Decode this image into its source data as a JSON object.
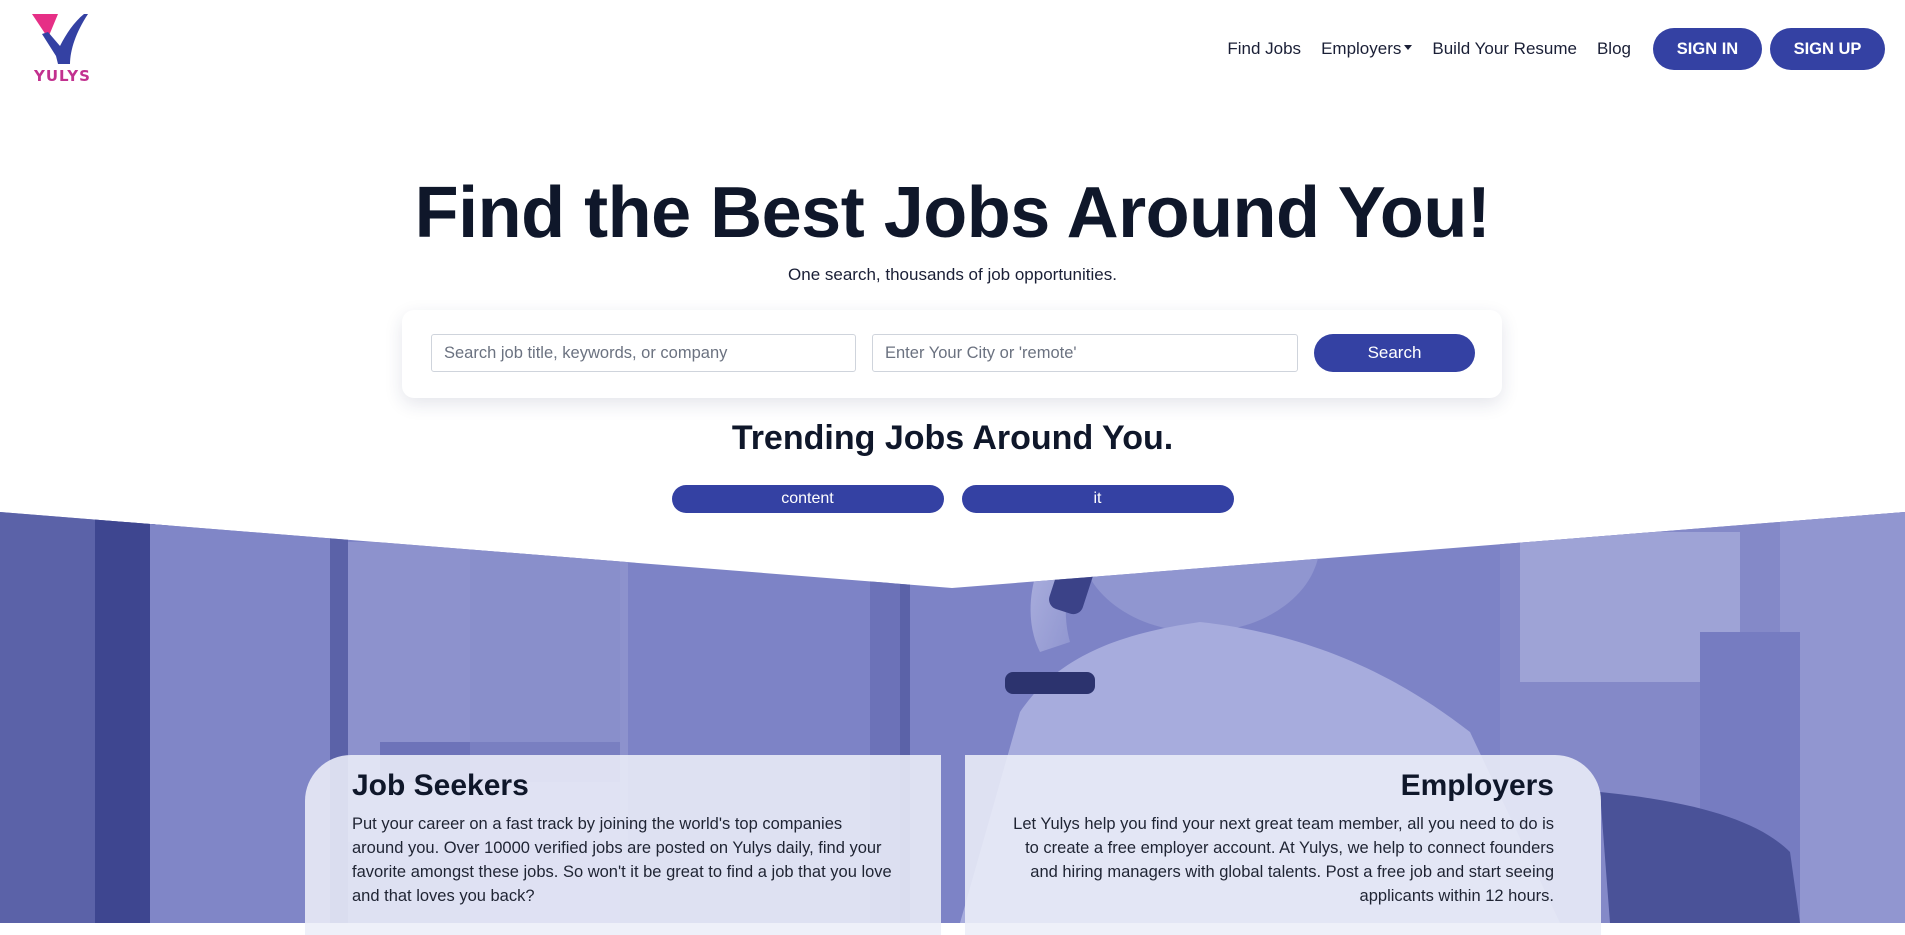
{
  "brand": {
    "name": "YULYS",
    "colors": {
      "primary": "#3441a3",
      "magenta": "#c2318f",
      "pink": "#e62f86"
    }
  },
  "nav": {
    "find_jobs": "Find Jobs",
    "employers": "Employers",
    "build_resume": "Build Your Resume",
    "blog": "Blog",
    "sign_in": "SIGN IN",
    "sign_up": "SIGN UP"
  },
  "hero": {
    "title": "Find the Best Jobs Around You!",
    "subtitle": "One search, thousands of job opportunities."
  },
  "search": {
    "keyword_placeholder": "Search job title, keywords, or company",
    "keyword_value": "",
    "city_placeholder": "Enter Your City or 'remote'",
    "city_value": "",
    "button": "Search"
  },
  "trending": {
    "title": "Trending Jobs Around You.",
    "tags": [
      "content",
      "it"
    ]
  },
  "cards": {
    "seekers": {
      "title": "Job Seekers",
      "text": "Put your career on a fast track by joining the world's top companies around you. Over 10000 verified jobs are posted on Yulys daily, find your favorite amongst these jobs. So won't it be great to find a job that you love and that loves you back?"
    },
    "employers": {
      "title": "Employers",
      "text": "Let Yulys help you find your next great team member, all you need to do is to create a free employer account. At Yulys, we help to connect founders and hiring managers with global talents. Post a free job and start seeing applicants within 12 hours."
    }
  }
}
